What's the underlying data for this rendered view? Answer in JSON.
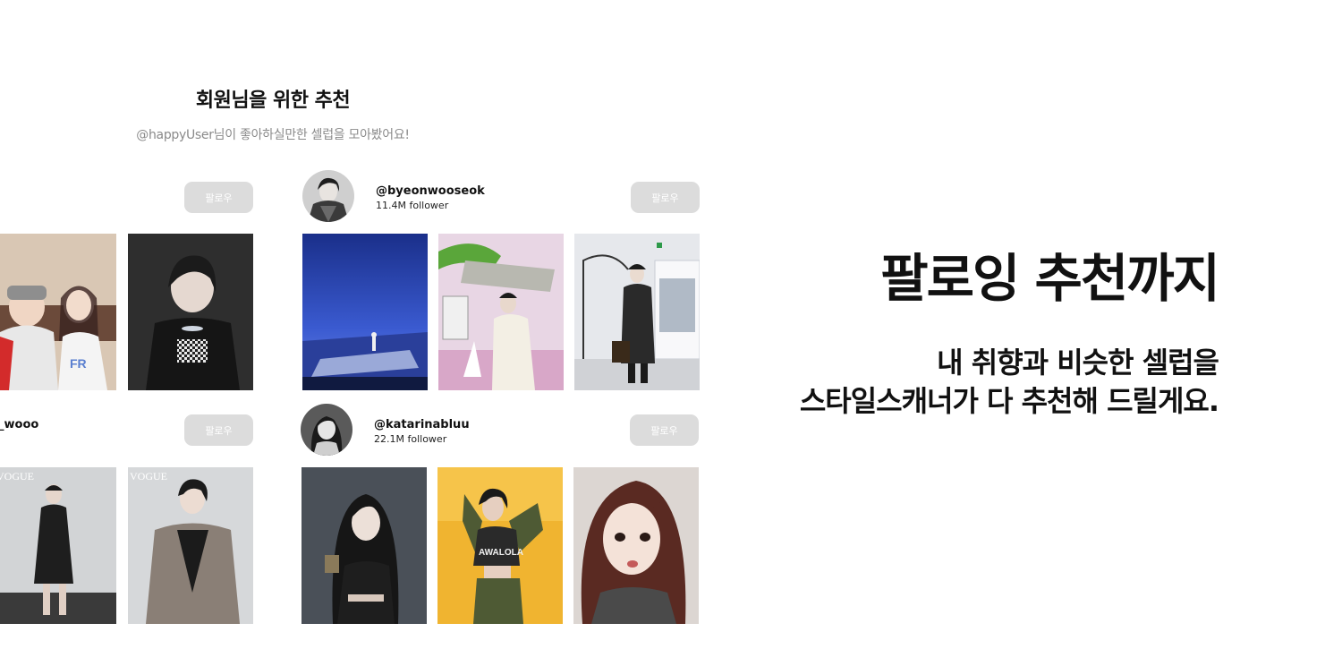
{
  "section": {
    "title": "회원님을 위한 추천",
    "subtitle": "@happyUser님이 좋아하실만한 셀럽을 모아봤어요!"
  },
  "follow_label": "팔로우",
  "cards": [
    {
      "handle": "",
      "followers": ""
    },
    {
      "handle": "@byeonwooseok",
      "followers": "11.4M follower"
    },
    {
      "handle": "_wooo",
      "followers": ""
    },
    {
      "handle": "@katarinabluu",
      "followers": "22.1M follower"
    }
  ],
  "promo": {
    "title": "팔로잉 추천까지",
    "line1": "내 취향과 비슷한 셀럽을",
    "line2": "스타일스캐너가 다 추천해 드릴게요."
  },
  "photo_captions": {
    "vogue": "VOGUE",
    "jersey": "AWALOLA"
  }
}
